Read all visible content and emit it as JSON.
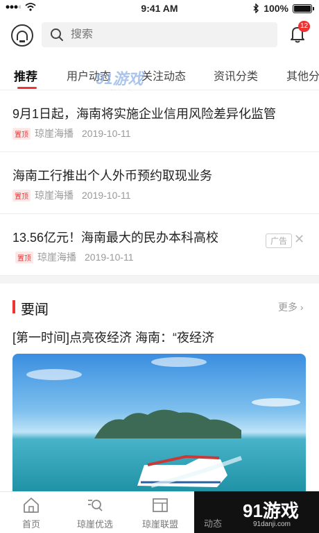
{
  "status_bar": {
    "time": "9:41 AM",
    "battery": "100%"
  },
  "search": {
    "placeholder": "搜索"
  },
  "notifications": {
    "count": "12"
  },
  "tabs": [
    {
      "label": "推荐",
      "active": true
    },
    {
      "label": "用户动态"
    },
    {
      "label": "关注动态"
    },
    {
      "label": "资讯分类"
    },
    {
      "label": "其他分类"
    }
  ],
  "watermark": {
    "brand": "91游戏",
    "domain": "91danji.com"
  },
  "news": [
    {
      "title": "9月1日起，海南将实施企业信用风险差异化监管",
      "tag": "置顶",
      "source": "琼崖海播",
      "date": "2019-10-11"
    },
    {
      "title": "海南工行推出个人外币预约取现业务",
      "tag": "置顶",
      "source": "琼崖海播",
      "date": "2019-10-11"
    },
    {
      "title": "13.56亿元！海南最大的民办本科高校",
      "tag": "置顶",
      "source": "琼崖海播",
      "date": "2019-10-11",
      "ad": "广告"
    }
  ],
  "section": {
    "title": "要闻",
    "more": "更多",
    "headline": "[第一时间]点亮夜经济 海南：“夜经济"
  },
  "bottom_nav": [
    {
      "label": "首页",
      "icon": "home-icon"
    },
    {
      "label": "琼崖优选",
      "icon": "search-list-icon"
    },
    {
      "label": "琼崖联盟",
      "icon": "alliance-icon"
    },
    {
      "label": "动态",
      "icon": "dynamic-icon"
    }
  ],
  "colors": {
    "accent": "#e33333",
    "text": "#222222",
    "muted": "#999999"
  }
}
